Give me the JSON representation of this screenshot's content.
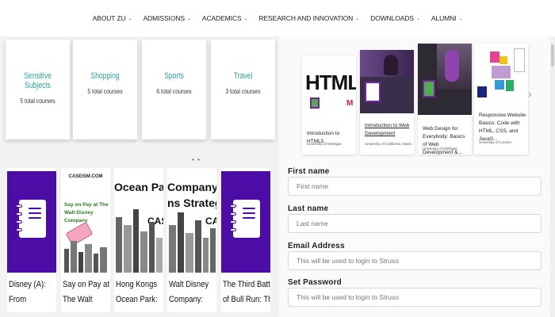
{
  "nav": {
    "items": [
      {
        "label": "ABOUT ZU"
      },
      {
        "label": "ADMISSIONS"
      },
      {
        "label": "ACADEMICS"
      },
      {
        "label": "RESEARCH AND INNOVATION"
      },
      {
        "label": "DOWNLOADS"
      },
      {
        "label": "ALUMNI"
      }
    ],
    "chevron_icon": "chevron-down-icon"
  },
  "categories": [
    {
      "title": "Sensitive Subjects",
      "count": "5 total courses"
    },
    {
      "title": "Shopping",
      "count": "5 total courses"
    },
    {
      "title": "Sports",
      "count": "6 total courses"
    },
    {
      "title": "Travel",
      "count": "3 total courses"
    }
  ],
  "books": [
    {
      "title_line1": "Disney (A):",
      "title_line2": "From"
    },
    {
      "title_line1": "Say on Pay at",
      "title_line2": "The Walt",
      "cover_brand": "CASEISM.COM",
      "cover_text": "Say on Pay at The Walt Disney Company"
    },
    {
      "title_line1": "Hong Kongs",
      "title_line2": "Ocean Park:",
      "cover_text": "Ocean Park Tal",
      "cover_tag": "CAS"
    },
    {
      "title_line1": "Walt Disney",
      "title_line2": "Company:",
      "cover_text": "Company Invest",
      "cover_text2": "ns Strategy",
      "cover_tag": "CAS"
    },
    {
      "title_line1": "The Third Battle",
      "title_line2": "of Bull Run: The"
    }
  ],
  "courses": [
    {
      "title": "Introduction to HTML5",
      "university": "University of Michigan",
      "cover_text": "HTML"
    },
    {
      "title": "Introduction to Web Development",
      "university": "University of California, Davis"
    },
    {
      "title": "Web Design for Everybody: Basics of Web Development &...",
      "university": "University of Michigan"
    },
    {
      "title": "Responsive Website Basics: Code with HTML, CSS, and JavaS...",
      "university": "University of London"
    }
  ],
  "form": {
    "first_name_label": "First name",
    "first_name_placeholder": "First name",
    "last_name_label": "Last name",
    "last_name_placeholder": "Last name",
    "email_label": "Email Address",
    "email_placeholder": "This will be used to login to Struso",
    "password_label": "Set Password",
    "password_placeholder": "This will be used to login to Struso"
  },
  "colors": {
    "accent_teal": "#2aa39a",
    "brand_purple": "#4b0da6"
  }
}
